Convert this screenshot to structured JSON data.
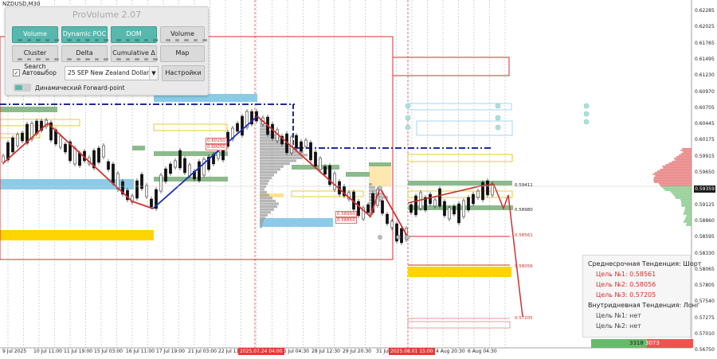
{
  "symbol": "NZDUSD,M30",
  "panel": {
    "title": "ProVolume 2.07",
    "buttons": {
      "volume_profile": "Volume Profile",
      "dynamic_poc": "Dynamic POC",
      "dom": "DOM",
      "volume": "Volume",
      "cluster_search": "Cluster Search",
      "delta": "Delta",
      "cumulative_delta": "Cumulative Δ",
      "map": "Map",
      "settings": "Настройки"
    },
    "autoselect_label": "Автовыбор",
    "autoselect_checked": true,
    "instrument": "25 SEP New Zealand Dollar",
    "forward_point_label": "Динамический Forward-point",
    "active_color": "#58b8ae"
  },
  "price_axis": [
    "0.62285",
    "0.62025",
    "0.61765",
    "0.61495",
    "0.61230",
    "0.60970",
    "0.60705",
    "0.60445",
    "0.60175",
    "0.59915",
    "0.59650",
    "0.59390",
    "0.59125",
    "0.58860",
    "0.58595",
    "0.58330",
    "0.58065",
    "0.57805",
    "0.57540",
    "0.57275",
    "0.57010",
    "0.56750"
  ],
  "current_price": "0.59359",
  "date_axis": [
    "9 Jul 2025",
    "10 Jul 11:00",
    "11 Jul 19:00",
    "15 Jul 03:00",
    "16 Jul 11:00",
    "17 Jul 19:00",
    "21 Jul 03:00",
    "22 Jul 11:00",
    "25 Jul 04:30",
    "28 Jul 12:30",
    "29 Jul 20:30",
    "31 Jul",
    "4 Aug 20:30",
    "6 Aug 04:30"
  ],
  "date_highlights": [
    "2025.07.24 04:00",
    "2025.08.01 15:00"
  ],
  "level_labels": {
    "upper": "0.59411",
    "mid": "0.58980",
    "red1": "0.58561",
    "red2": "0.58056",
    "red3": "0.57205"
  },
  "box_labels": {
    "a": "0.60150",
    "b": "0.60050",
    "c": "0.58950",
    "d": "0.58850"
  },
  "trend": {
    "mid_term": "Среднесрочная Тенденция: Шорт",
    "target1": "Цель №1:  0.58561",
    "target2": "Цель №2:  0.58056",
    "target3": "Цель №3:  0.57205",
    "intraday": "Внутридневная Тенденция: Лонг",
    "intra1": "Цель №1:  нет",
    "intra2": "Цель №2:  нет"
  },
  "volume_bar": {
    "buy": "3318",
    "sell": "3073"
  },
  "colors": {
    "accent": "#58b8ae",
    "red": "#d32f2f",
    "blue": "#1a2dbf",
    "navy": "#1f2a9e",
    "green_zone": "#7fb27f",
    "yellow_zone": "#ffd400",
    "sky_zone": "#8ccbe8"
  }
}
